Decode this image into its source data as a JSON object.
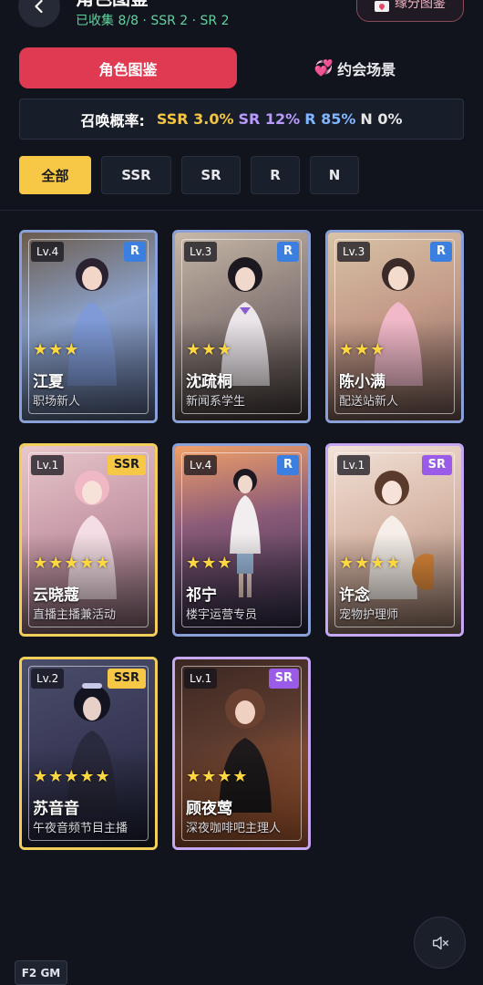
{
  "header": {
    "title": "角色图鉴",
    "subtitle": "已收集 8/8 · SSR 2 · SR 2",
    "fate_button": "缘分图鉴"
  },
  "tabs": {
    "main": "角色图鉴",
    "date": "约会场景",
    "date_icon": "💞"
  },
  "rates": {
    "label": "召唤概率:",
    "ssr": "SSR 3.0%",
    "sr": "SR 12%",
    "r": "R 85%",
    "n": "N 0%"
  },
  "filters": [
    "全部",
    "SSR",
    "SR",
    "R",
    "N"
  ],
  "cards": [
    {
      "level": "Lv.4",
      "rarity": "R",
      "stars": "★★★",
      "name": "江夏",
      "role": "职场新人"
    },
    {
      "level": "Lv.3",
      "rarity": "R",
      "stars": "★★★",
      "name": "沈疏桐",
      "role": "新闻系学生"
    },
    {
      "level": "Lv.3",
      "rarity": "R",
      "stars": "★★★",
      "name": "陈小满",
      "role": "配送站新人"
    },
    {
      "level": "Lv.1",
      "rarity": "SSR",
      "stars": "★★★★★",
      "name": "云晓蔻",
      "role": "直播主播兼活动"
    },
    {
      "level": "Lv.4",
      "rarity": "R",
      "stars": "★★★",
      "name": "祁宁",
      "role": "楼宇运营专员"
    },
    {
      "level": "Lv.1",
      "rarity": "SR",
      "stars": "★★★★",
      "name": "许念",
      "role": "宠物护理师"
    },
    {
      "level": "Lv.2",
      "rarity": "SSR",
      "stars": "★★★★★",
      "name": "苏音音",
      "role": "午夜音频节目主播"
    },
    {
      "level": "Lv.1",
      "rarity": "SR",
      "stars": "★★★★",
      "name": "顾夜莺",
      "role": "深夜咖啡吧主理人"
    }
  ],
  "footer": {
    "gm_label": "F2 GM"
  },
  "colors": {
    "accent_red": "#e03a52",
    "ssr": "#f4c542",
    "sr": "#b99bff",
    "r": "#7fb6ff",
    "active_filter": "#f6c845"
  }
}
